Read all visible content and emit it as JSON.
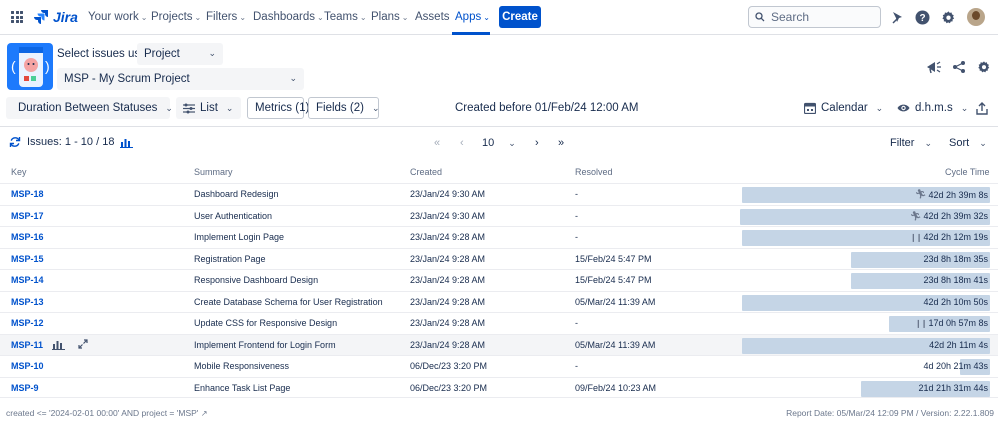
{
  "nav": {
    "logo": "Jira",
    "items": [
      {
        "label": "Your work",
        "dropdown": true
      },
      {
        "label": "Projects",
        "dropdown": true
      },
      {
        "label": "Filters",
        "dropdown": true
      },
      {
        "label": "Dashboards",
        "dropdown": true
      },
      {
        "label": "Teams",
        "dropdown": true
      },
      {
        "label": "Plans",
        "dropdown": true
      },
      {
        "label": "Assets",
        "dropdown": false
      },
      {
        "label": "Apps",
        "dropdown": true,
        "active": true
      }
    ],
    "create_label": "Create",
    "search_placeholder": "Search"
  },
  "header": {
    "select_label": "Select issues using",
    "select_type": "Project",
    "project": "MSP - My Scrum Project"
  },
  "toolbar": {
    "report": "Duration Between Statuses",
    "view": "List",
    "metrics": "Metrics (1)",
    "fields": "Fields (2)",
    "created_before": "Created  before 01/Feb/24 12:00 AM",
    "calendar": "Calendar",
    "format": "d.h.m.s"
  },
  "issues_bar": {
    "label": "Issues: 1 - 10 / 18",
    "page_size": "10",
    "filter": "Filter",
    "sort": "Sort"
  },
  "columns": {
    "key": "Key",
    "summary": "Summary",
    "created": "Created",
    "resolved": "Resolved",
    "cycle_time": "Cycle Time"
  },
  "rows": [
    {
      "key": "MSP-18",
      "summary": "Dashboard Redesign",
      "created": "23/Jan/24 9:30 AM",
      "resolved": "-",
      "cycle_time": "42d 2h 39m 8s",
      "bar_fraction": 0.98,
      "marker": "runner"
    },
    {
      "key": "MSP-17",
      "summary": "User Authentication",
      "created": "23/Jan/24 9:30 AM",
      "resolved": "-",
      "cycle_time": "42d 2h 39m 32s",
      "bar_fraction": 0.99,
      "marker": "runner"
    },
    {
      "key": "MSP-16",
      "summary": "Implement Login Page",
      "created": "23/Jan/24 9:28 AM",
      "resolved": "-",
      "cycle_time": "42d 2h 12m 19s",
      "bar_fraction": 0.98,
      "marker": "pause"
    },
    {
      "key": "MSP-15",
      "summary": "Registration Page",
      "created": "23/Jan/24 9:28 AM",
      "resolved": "15/Feb/24 5:47 PM",
      "cycle_time": "23d 8h 18m 35s",
      "bar_fraction": 0.55,
      "marker": ""
    },
    {
      "key": "MSP-14",
      "summary": "Responsive Dashboard Design",
      "created": "23/Jan/24 9:28 AM",
      "resolved": "15/Feb/24 5:47 PM",
      "cycle_time": "23d 8h 18m 41s",
      "bar_fraction": 0.55,
      "marker": ""
    },
    {
      "key": "MSP-13",
      "summary": "Create Database Schema for User Registration",
      "created": "23/Jan/24 9:28 AM",
      "resolved": "05/Mar/24 11:39 AM",
      "cycle_time": "42d 2h 10m 50s",
      "bar_fraction": 0.98,
      "marker": ""
    },
    {
      "key": "MSP-12",
      "summary": "Update CSS for Responsive Design",
      "created": "23/Jan/24 9:28 AM",
      "resolved": "-",
      "cycle_time": "17d 0h 57m 8s",
      "bar_fraction": 0.4,
      "marker": "pause"
    },
    {
      "key": "MSP-11",
      "summary": "Implement Frontend for Login Form",
      "created": "23/Jan/24 9:28 AM",
      "resolved": "05/Mar/24 11:39 AM",
      "cycle_time": "42d 2h 11m 4s",
      "bar_fraction": 0.98,
      "marker": "",
      "hovered": true
    },
    {
      "key": "MSP-10",
      "summary": "Mobile Responsiveness",
      "created": "06/Dec/23 3:20 PM",
      "resolved": "-",
      "cycle_time": "4d 20h 21m 43s",
      "bar_fraction": 0.12,
      "marker": ""
    },
    {
      "key": "MSP-9",
      "summary": "Enhance Task List Page",
      "created": "06/Dec/23 3:20 PM",
      "resolved": "09/Feb/24 10:23 AM",
      "cycle_time": "21d 21h 31m 44s",
      "bar_fraction": 0.51,
      "marker": ""
    }
  ],
  "footer": {
    "jql": "created <= '2024-02-01 00:00' AND project = 'MSP'",
    "report": "Report Date: 05/Mar/24 12:09 PM / Version: 2.22.1.809"
  },
  "colors": {
    "accent": "#0052cc",
    "bar": "#c5d5e6"
  }
}
